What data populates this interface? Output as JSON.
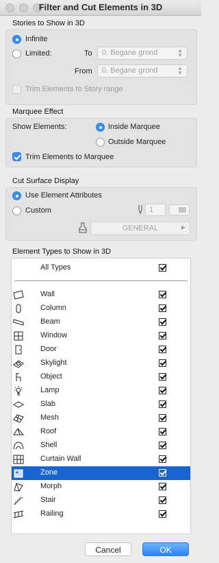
{
  "window": {
    "title": "Filter and Cut Elements in 3D"
  },
  "stories": {
    "header": "Stories to Show in 3D",
    "infinite": "Infinite",
    "limited": "Limited:",
    "to_label": "To",
    "to_value": "0. Begane grond",
    "from_label": "From",
    "from_value": "0. Begane grond",
    "trim": "Trim Elements to Story range"
  },
  "marquee": {
    "header": "Marquee Effect",
    "show_label": "Show Elements:",
    "inside": "Inside Marquee",
    "outside": "Outside Marquee",
    "trim": "Trim Elements to Marquee"
  },
  "cut": {
    "header": "Cut Surface Display",
    "use_attr": "Use Element Attributes",
    "custom": "Custom",
    "pen_value": "1",
    "fill_value": "GENERAL"
  },
  "types": {
    "header": "Element Types to Show in 3D",
    "all_label": "All Types",
    "items": [
      {
        "name": "Wall",
        "icon": "wall-icon"
      },
      {
        "name": "Column",
        "icon": "column-icon"
      },
      {
        "name": "Beam",
        "icon": "beam-icon"
      },
      {
        "name": "Window",
        "icon": "window-icon"
      },
      {
        "name": "Door",
        "icon": "door-icon"
      },
      {
        "name": "Skylight",
        "icon": "skylight-icon"
      },
      {
        "name": "Object",
        "icon": "object-icon"
      },
      {
        "name": "Lamp",
        "icon": "lamp-icon"
      },
      {
        "name": "Slab",
        "icon": "slab-icon"
      },
      {
        "name": "Mesh",
        "icon": "mesh-icon"
      },
      {
        "name": "Roof",
        "icon": "roof-icon"
      },
      {
        "name": "Shell",
        "icon": "shell-icon"
      },
      {
        "name": "Curtain Wall",
        "icon": "curtain-wall-icon"
      },
      {
        "name": "Zone",
        "icon": "zone-icon"
      },
      {
        "name": "Morph",
        "icon": "morph-icon"
      },
      {
        "name": "Stair",
        "icon": "stair-icon"
      },
      {
        "name": "Railing",
        "icon": "railing-icon"
      }
    ]
  },
  "buttons": {
    "cancel": "Cancel",
    "ok": "OK"
  },
  "colors": {
    "accent": "#3b8ef5",
    "selection": "#1865d0"
  }
}
